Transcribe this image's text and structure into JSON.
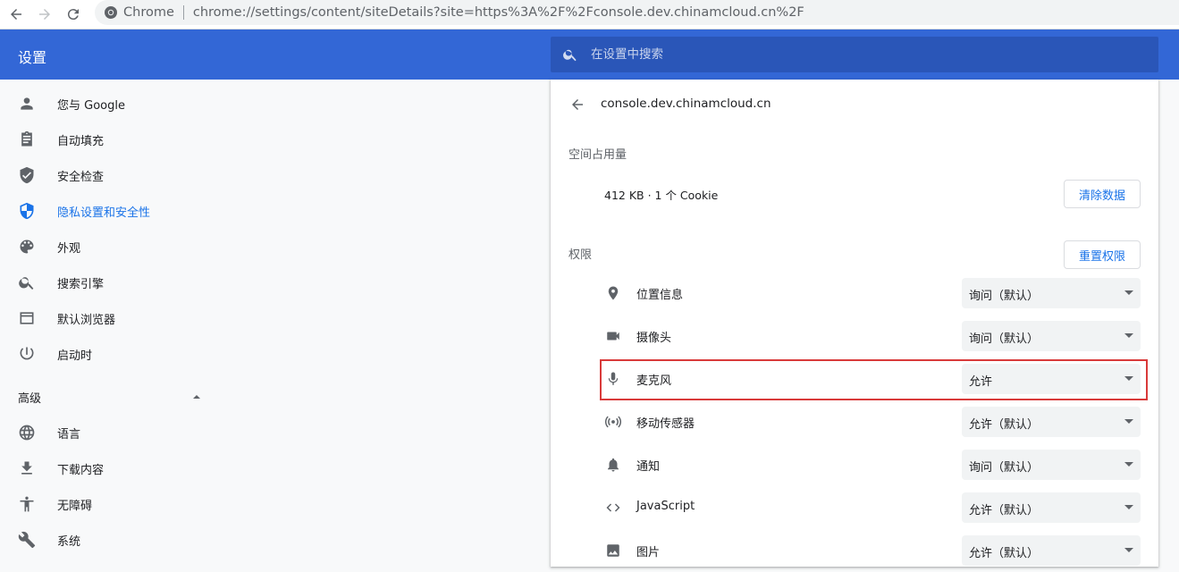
{
  "browser": {
    "omnibox_label": "Chrome",
    "url": "chrome://settings/content/siteDetails?site=https%3A%2F%2Fconsole.dev.chinamcloud.cn%2F"
  },
  "header": {
    "title": "设置",
    "search_placeholder": "在设置中搜索"
  },
  "sidebar": {
    "items": [
      {
        "label": "您与 Google",
        "icon": "person-icon"
      },
      {
        "label": "自动填充",
        "icon": "clipboard-icon"
      },
      {
        "label": "安全检查",
        "icon": "shield-check-icon"
      },
      {
        "label": "隐私设置和安全性",
        "icon": "shield-icon"
      },
      {
        "label": "外观",
        "icon": "palette-icon"
      },
      {
        "label": "搜索引擎",
        "icon": "search-icon"
      },
      {
        "label": "默认浏览器",
        "icon": "browser-icon"
      },
      {
        "label": "启动时",
        "icon": "power-icon"
      }
    ],
    "advanced_label": "高级",
    "advanced_items": [
      {
        "label": "语言",
        "icon": "globe-icon"
      },
      {
        "label": "下载内容",
        "icon": "download-icon"
      },
      {
        "label": "无障碍",
        "icon": "accessibility-icon"
      },
      {
        "label": "系统",
        "icon": "wrench-icon"
      }
    ]
  },
  "site": {
    "title": "console.dev.chinamcloud.cn",
    "usage_label": "空间占用量",
    "usage_value": "412 KB · 1 个 Cookie",
    "clear_button": "清除数据",
    "permissions_label": "权限",
    "reset_button": "重置权限",
    "permissions": [
      {
        "label": "位置信息",
        "value": "询问（默认）",
        "icon": "location-icon"
      },
      {
        "label": "摄像头",
        "value": "询问（默认）",
        "icon": "camera-icon"
      },
      {
        "label": "麦克风",
        "value": "允许",
        "icon": "microphone-icon"
      },
      {
        "label": "移动传感器",
        "value": "允许（默认）",
        "icon": "sensors-icon"
      },
      {
        "label": "通知",
        "value": "询问（默认）",
        "icon": "bell-icon"
      },
      {
        "label": "JavaScript",
        "value": "允许（默认）",
        "icon": "code-icon"
      },
      {
        "label": "图片",
        "value": "允许（默认）",
        "icon": "image-icon"
      }
    ]
  },
  "colors": {
    "header_blue": "#3367d6",
    "active_blue": "#1a73e8",
    "highlight_red": "#d93a3a"
  }
}
